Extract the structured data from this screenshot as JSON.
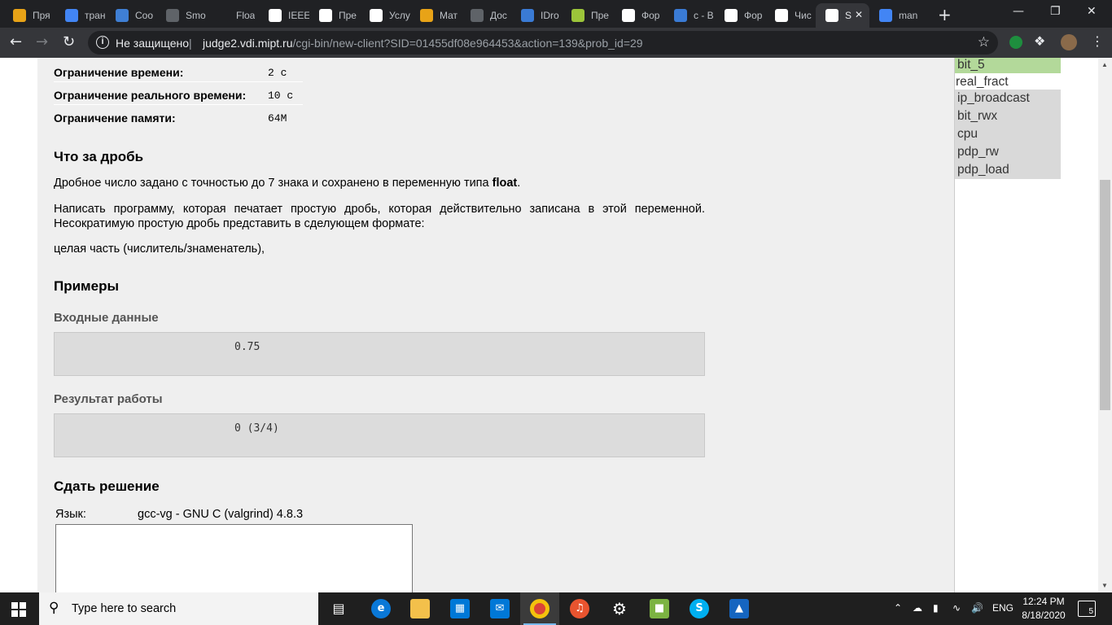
{
  "browser": {
    "tabs": [
      {
        "title": "Пря",
        "icon": "bookmark-icon",
        "color": "#e8a317"
      },
      {
        "title": "тран",
        "icon": "google-icon",
        "color": "#4285f4"
      },
      {
        "title": "Coo",
        "icon": "chat-icon",
        "color": "#3f7fd4"
      },
      {
        "title": "Smo",
        "icon": "globe-icon",
        "color": "#5f6368"
      },
      {
        "title": "Floa",
        "icon": "blank-icon",
        "color": "#202124"
      },
      {
        "title": "IEEE",
        "icon": "wikipedia-icon",
        "color": "#ffffff"
      },
      {
        "title": "Пре",
        "icon": "dp-icon",
        "color": "#ffffff"
      },
      {
        "title": "Услу",
        "icon": "globe-icon",
        "color": "#ffffff"
      },
      {
        "title": "Мат",
        "icon": "m-icon",
        "color": "#e8a317"
      },
      {
        "title": "Дос",
        "icon": "globe-icon",
        "color": "#5f6368"
      },
      {
        "title": "IDro",
        "icon": "grid-icon",
        "color": "#3a7bd5"
      },
      {
        "title": "Пре",
        "icon": "book-icon",
        "color": "#9cc53a"
      },
      {
        "title": "Фор",
        "icon": "page-icon",
        "color": "#ffffff"
      },
      {
        "title": "c - В",
        "icon": "stack-icon",
        "color": "#3a7bd5"
      },
      {
        "title": "Фор",
        "icon": "page-icon",
        "color": "#ffffff"
      },
      {
        "title": "Чис",
        "icon": "wikipedia-icon",
        "color": "#ffffff"
      },
      {
        "title": "S",
        "icon": "globe-icon",
        "color": "#ffffff",
        "active": true
      },
      {
        "title": "man",
        "icon": "google-icon",
        "color": "#4285f4"
      }
    ],
    "security_label": "Не защищено",
    "url_host": "judge2.vdi.mipt.ru",
    "url_path": "/cgi-bin/new-client?SID=01455df08e964453&action=139&prob_id=29"
  },
  "problem": {
    "limits": [
      {
        "label": "Ограничение времени:",
        "value": "2 с"
      },
      {
        "label": "Ограничение реального времени:",
        "value": "10 с"
      },
      {
        "label": "Ограничение памяти:",
        "value": "64M"
      }
    ],
    "title": "Что за дробь",
    "p1_text": "Дробное число задано с точностью до 7 знака и сохранено в переменную типа",
    "p1_bold": "float",
    "p1_end": ".",
    "p2": "Написать программу, которая печатает простую дробь, которая действительно записана в этой переменной. Несократимую простую дробь представить в сделующем формате:",
    "p3": "целая часть (числитель/знаменатель),",
    "examples_title": "Примеры",
    "input_label": "Входные данные",
    "input_value": "0.75",
    "output_label": "Результат работы",
    "output_value": "0 (3/4)",
    "submit_title": "Сдать решение",
    "lang_label": "Язык:",
    "lang_value": "gcc-vg - GNU C (valgrind) 4.8.3"
  },
  "problem_nav": [
    {
      "label": "bit_5",
      "state": "solved"
    },
    {
      "label": "real_fract",
      "state": "current"
    },
    {
      "label": "ip_broadcast",
      "state": "normal"
    },
    {
      "label": "bit_rwx",
      "state": "normal"
    },
    {
      "label": "cpu",
      "state": "normal"
    },
    {
      "label": "pdp_rw",
      "state": "normal"
    },
    {
      "label": "pdp_load",
      "state": "normal"
    }
  ],
  "taskbar": {
    "search_placeholder": "Type here to search",
    "language": "ENG",
    "time": "12:24 PM",
    "date": "8/18/2020",
    "notification_count": "5"
  }
}
